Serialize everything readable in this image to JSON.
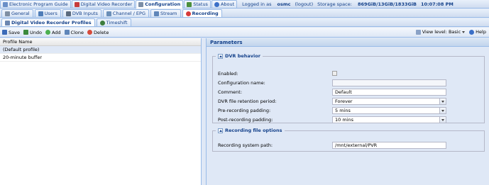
{
  "top_tabs": [
    {
      "label": "Electronic Program Guide",
      "icon": "epg-icon",
      "color": "#6a8fc7"
    },
    {
      "label": "Digital Video Recorder",
      "icon": "dvr-icon",
      "color": "#c73b3b"
    },
    {
      "label": "Configuration",
      "icon": "wrench-icon",
      "color": "#7c8ea6",
      "active": true
    },
    {
      "label": "Status",
      "icon": "status-icon",
      "color": "#4b8f3c"
    },
    {
      "label": "About",
      "icon": "info-icon",
      "color": "#3b6fc7"
    }
  ],
  "session": {
    "logged_in_prefix": "Logged in as",
    "username": "osmc",
    "logout": "(logout)",
    "storage_label": "Storage space:",
    "storage_value": "869GiB/13GiB/1833GiB",
    "time": "10:07:08 PM"
  },
  "config_tabs": [
    {
      "label": "General",
      "icon": "gear-icon",
      "color": "#7f8fa3"
    },
    {
      "label": "Users",
      "icon": "users-icon",
      "color": "#4f7db8"
    },
    {
      "label": "DVB Inputs",
      "icon": "dvb-icon",
      "color": "#5a6a7e"
    },
    {
      "label": "Channel / EPG",
      "icon": "channel-icon",
      "color": "#6b8fb8"
    },
    {
      "label": "Stream",
      "icon": "stream-icon",
      "color": "#5f86b9"
    },
    {
      "label": "Recording",
      "icon": "record-icon",
      "color": "#d63b3b",
      "active": true
    }
  ],
  "recording_tabs": [
    {
      "label": "Digital Video Recorder Profiles",
      "icon": "profile-icon",
      "color": "#6c86b0",
      "active": true
    },
    {
      "label": "Timeshift",
      "icon": "timeshift-icon",
      "color": "#3d7d3d"
    }
  ],
  "toolbar": {
    "buttons": [
      {
        "label": "Save",
        "icon": "save-icon",
        "color": "#3b6bb8"
      },
      {
        "label": "Undo",
        "icon": "undo-icon",
        "color": "#3c8a3c"
      },
      {
        "label": "Add",
        "icon": "add-icon",
        "color": "#4caf50"
      },
      {
        "label": "Clone",
        "icon": "clone-icon",
        "color": "#5f86b9"
      },
      {
        "label": "Delete",
        "icon": "delete-icon",
        "color": "#d64b3b"
      }
    ],
    "view_level_label": "View level: Basic",
    "help": "Help"
  },
  "grid": {
    "column": "Profile Name",
    "rows": [
      "(Default profile)",
      "20-minute buffer"
    ]
  },
  "parameters": {
    "title": "Parameters",
    "dvr_behavior": {
      "legend": "DVR behavior",
      "enabled_label": "Enabled:",
      "config_name_label": "Configuration name:",
      "config_name_value": "",
      "comment_label": "Comment:",
      "comment_value": "Default",
      "retention_label": "DVR file retention period:",
      "retention_value": "Forever",
      "pre_label": "Pre-recording padding:",
      "pre_value": "5 mins",
      "post_label": "Post-recording padding:",
      "post_value": "10 mins"
    },
    "recording_file_options": {
      "legend": "Recording file options",
      "path_label": "Recording system path:",
      "path_value": "/mnt/external/PVR"
    }
  }
}
